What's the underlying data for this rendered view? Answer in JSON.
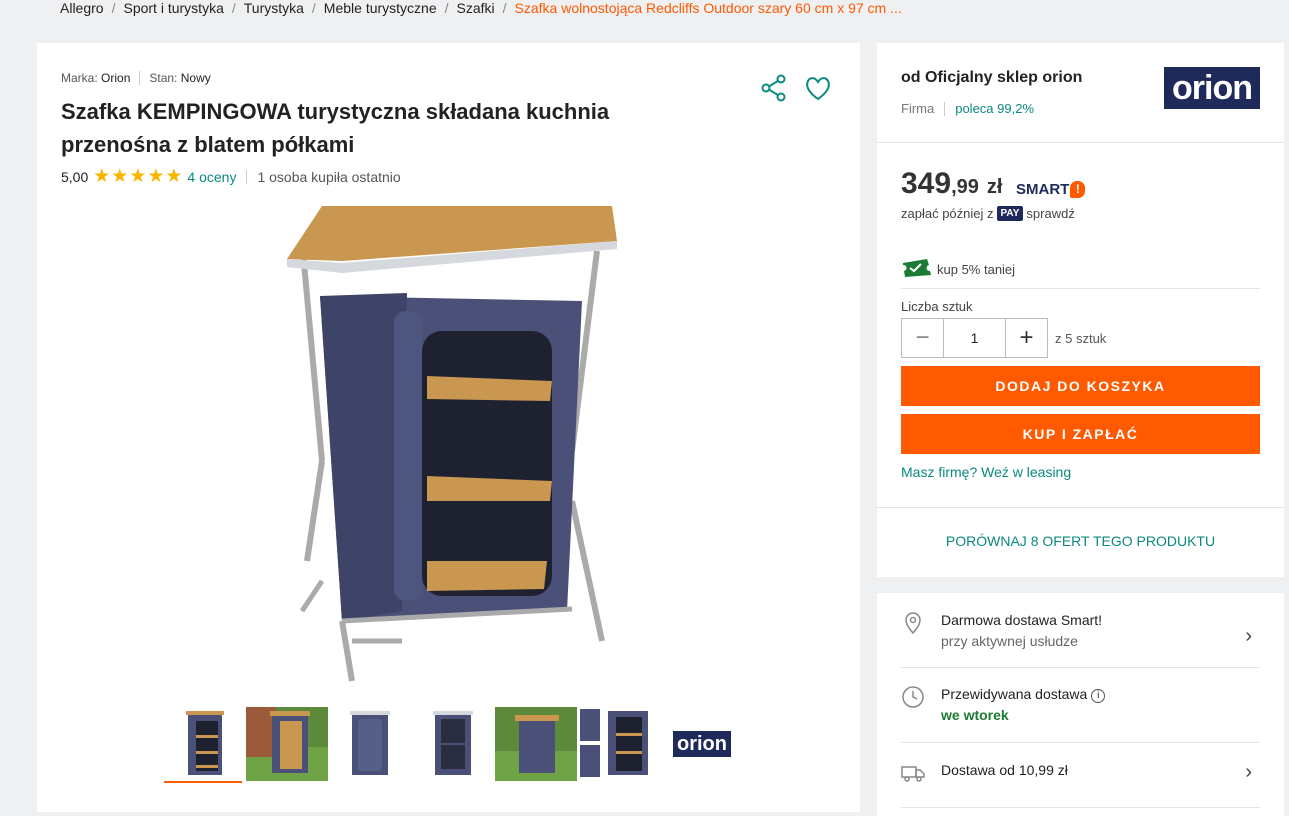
{
  "breadcrumb": {
    "items": [
      "Allegro",
      "Sport i turystyka",
      "Turystyka",
      "Meble turystyczne",
      "Szafki"
    ],
    "current": "Szafka wolnostojąca Redcliffs Outdoor szary 60 cm x 97 cm ..."
  },
  "product": {
    "brand_label": "Marka:",
    "brand": "Orion",
    "condition_label": "Stan:",
    "condition": "Nowy",
    "title": "Szafka KEMPINGOWA turystyczna składana kuchnia przenośna z blatem półkami",
    "rating_value": "5,00",
    "stars": "★★★★★",
    "rating_count": "4 oceny",
    "bought": "1 osoba kupiła ostatnio",
    "thumbnail_count": 7
  },
  "seller": {
    "name": "od Oficjalny sklep orion",
    "type": "Firma",
    "recommend": "poleca 99,2%",
    "logo_text": "orion"
  },
  "offer": {
    "price_int": "349",
    "price_dec": ",99",
    "currency": "zł",
    "smart_label": "SMART",
    "pay_later_pre": "zapłać później z",
    "pay_badge": "PAY",
    "pay_later_post": "sprawdź",
    "discount": "kup 5% taniej",
    "qty_label": "Liczba sztuk",
    "qty_value": "1",
    "qty_of": "z 5 sztuk",
    "add_to_cart": "DODAJ DO KOSZYKA",
    "buy_now": "KUP I ZAPŁAĆ",
    "leasing": "Masz firmę? Weź w leasing",
    "compare": "PORÓWNAJ 8 OFERT TEGO PRODUKTU"
  },
  "delivery": {
    "free_title": "Darmowa dostawa Smart!",
    "free_sub": "przy aktywnej usłudze",
    "expected_title": "Przewidywana dostawa",
    "expected_day": "we wtorek",
    "cost": "Dostawa od 10,99 zł"
  },
  "colors": {
    "accent": "#ff5a00",
    "link": "#0a8a7f",
    "brand_navy": "#1e2a5a",
    "star": "#f7b500"
  }
}
